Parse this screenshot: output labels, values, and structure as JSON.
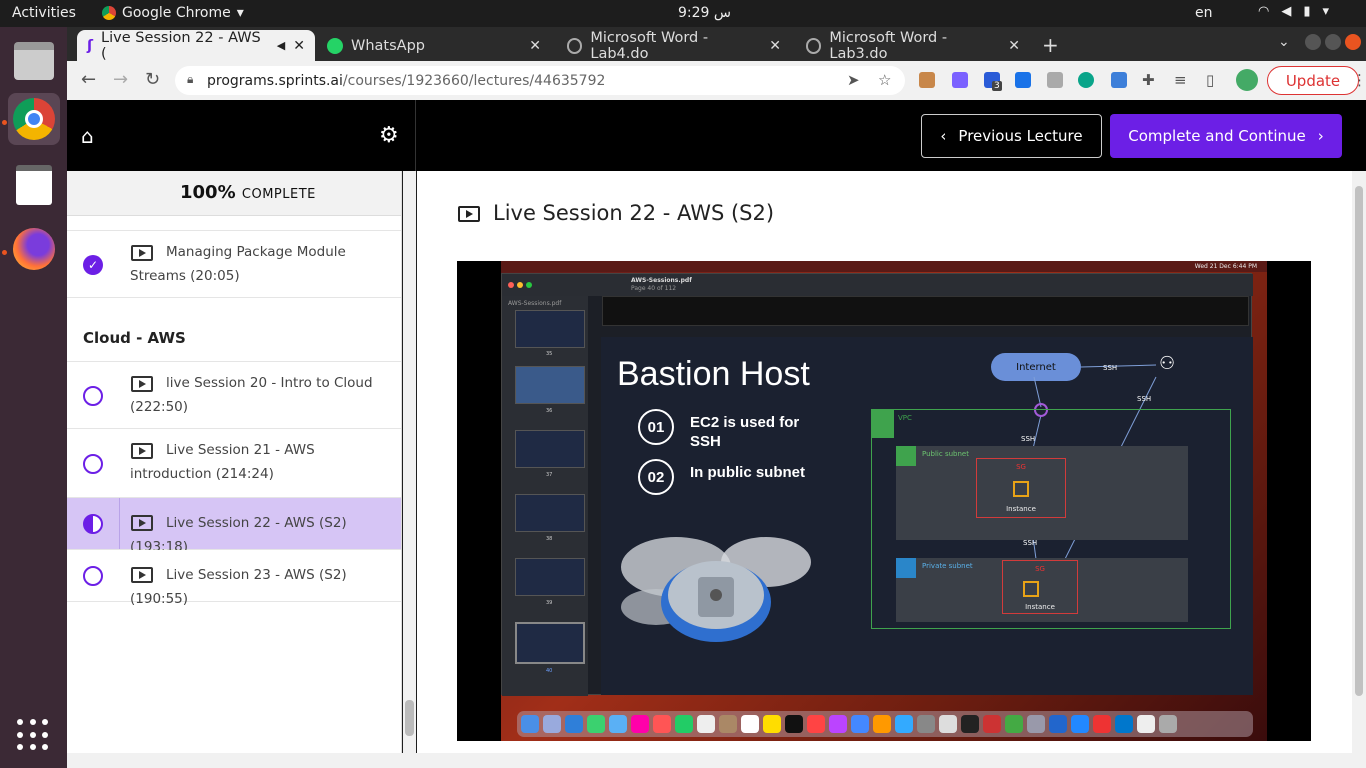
{
  "topbar": {
    "activities": "Activities",
    "app_name": "Google Chrome",
    "clock": "9:29 س",
    "lang": "en"
  },
  "tabs": [
    {
      "title": "Live Session 22 - AWS (",
      "active": true
    },
    {
      "title": "WhatsApp",
      "active": false
    },
    {
      "title": "Microsoft Word - Lab4.do",
      "active": false
    },
    {
      "title": "Microsoft Word - Lab3.do",
      "active": false
    }
  ],
  "address": {
    "host": "programs.sprints.ai",
    "path": "/courses/1923660/lectures/44635792"
  },
  "toolbar": {
    "update_label": "Update",
    "ext_badge": "3"
  },
  "header": {
    "prev_label": "Previous Lecture",
    "next_label": "Complete and Continue"
  },
  "sidebar": {
    "progress_percent": "100%",
    "progress_label": "COMPLETE",
    "section_title": "Cloud - AWS",
    "lectures": [
      {
        "title": "Managing Package Module Streams (20:05)",
        "status": "done"
      },
      {
        "title": "live Session 20 - Intro to Cloud (222:50)",
        "status": "todo"
      },
      {
        "title": "Live Session 21 - AWS introduction (214:24)",
        "status": "todo"
      },
      {
        "title": "Live Session 22 - AWS (S2) (193:18)",
        "status": "half"
      },
      {
        "title": "Live Session 23 - AWS (S2) (190:55)",
        "status": "todo"
      }
    ]
  },
  "main": {
    "lecture_title": "Live Session 22 - AWS (S2)"
  },
  "video": {
    "pdf_name": "AWS-Sessions.pdf",
    "pdf_page": "Page 40 of 112",
    "sidebar_title": "AWS-Sessions.pdf",
    "thumb_pages": [
      "35",
      "36",
      "37",
      "38",
      "39",
      "40"
    ],
    "mac_date": "Wed 21 Dec 6:44 PM",
    "slide": {
      "title": "Bastion Host",
      "bullets": [
        {
          "num": "01",
          "text": "EC2 is used for SSH"
        },
        {
          "num": "02",
          "text": "In public subnet"
        }
      ],
      "internet": "Internet",
      "vpc": "VPC",
      "public_subnet": "Public subnet",
      "private_subnet": "Private subnet",
      "sg": "SG",
      "instance": "Instance",
      "ssh": "SSH"
    }
  }
}
